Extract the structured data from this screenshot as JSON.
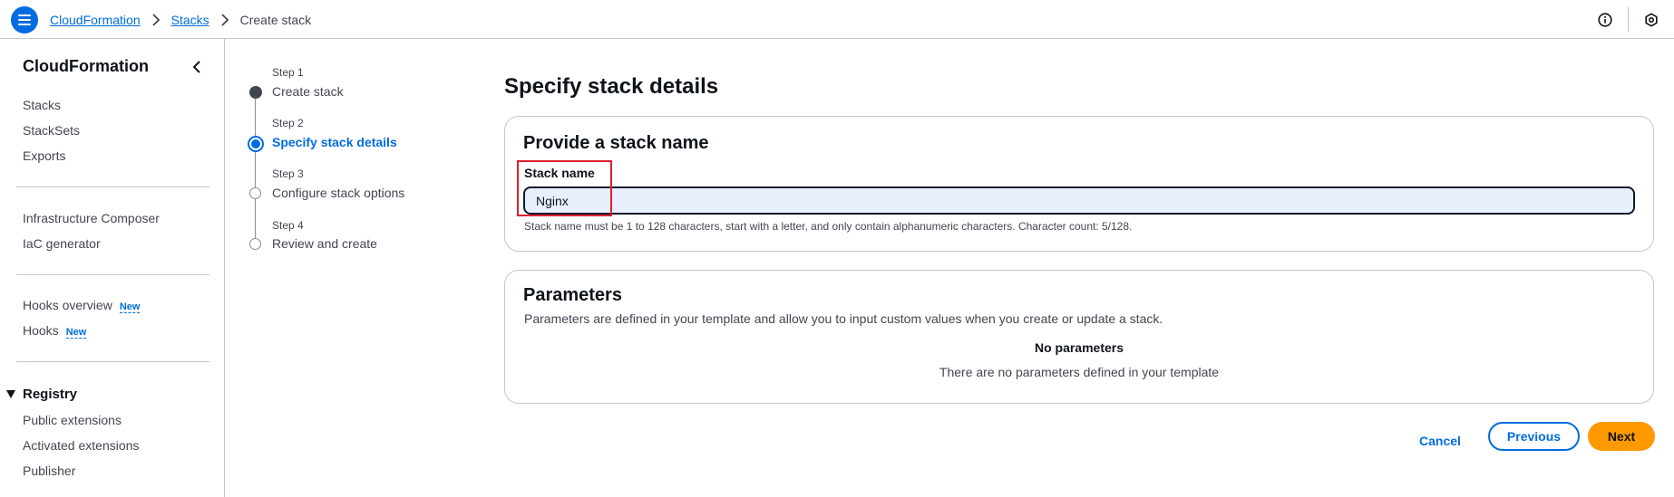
{
  "topbar": {
    "breadcrumb": [
      "CloudFormation",
      "Stacks",
      "Create stack"
    ],
    "icons": [
      "menu-icon",
      "chevron-right-icon",
      "info-icon",
      "settings-icon"
    ]
  },
  "sidebar": {
    "title": "CloudFormation",
    "items": [
      {
        "label": "Stacks"
      },
      {
        "label": "StackSets"
      },
      {
        "label": "Exports"
      },
      {
        "label": "Infrastructure Composer"
      },
      {
        "label": "IaC generator"
      },
      {
        "label": "Hooks overview",
        "badge": "New"
      },
      {
        "label": "Hooks",
        "badge": "New"
      }
    ],
    "registry": {
      "title": "Registry",
      "items": [
        "Public extensions",
        "Activated extensions",
        "Publisher"
      ]
    }
  },
  "steps": [
    {
      "step": "Step 1",
      "name": "Create stack",
      "status": "complete"
    },
    {
      "step": "Step 2",
      "name": "Specify stack details",
      "status": "current"
    },
    {
      "step": "Step 3",
      "name": "Configure stack options",
      "status": "upcoming"
    },
    {
      "step": "Step 4",
      "name": "Review and create",
      "status": "upcoming"
    }
  ],
  "main": {
    "title": "Specify stack details",
    "stack_name_panel": {
      "heading": "Provide a stack name",
      "label": "Stack name",
      "value": "Nginx",
      "hint": "Stack name must be 1 to 128 characters, start with a letter, and only contain alphanumeric characters. Character count: 5/128."
    },
    "parameters_panel": {
      "heading": "Parameters",
      "description": "Parameters are defined in your template and allow you to input custom values when you create or update a stack.",
      "empty_title": "No parameters",
      "empty_description": "There are no parameters defined in your template"
    }
  },
  "actions": {
    "cancel": "Cancel",
    "previous": "Previous",
    "next": "Next"
  },
  "colors": {
    "accent": "#006ce0",
    "primary_button": "#ff9900",
    "highlight_box": "#e0202c"
  }
}
